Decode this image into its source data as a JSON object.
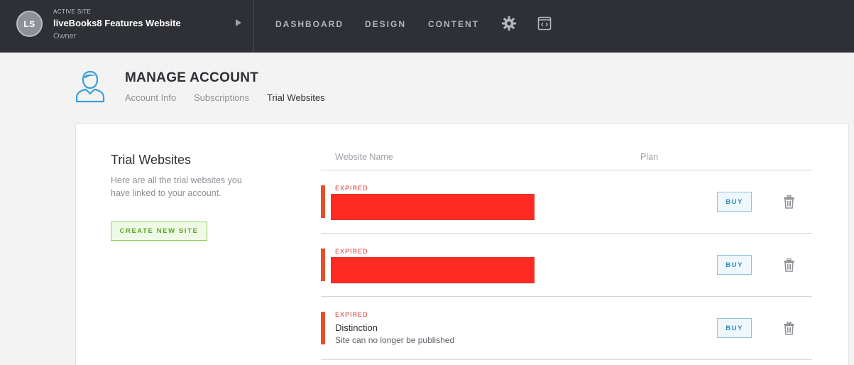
{
  "topbar": {
    "avatar_initials": "LS",
    "active_site_label": "ACTIVE SITE",
    "site_name": "liveBooks8 Features Website",
    "site_role": "Owner",
    "nav": [
      {
        "label": "DASHBOARD"
      },
      {
        "label": "DESIGN"
      },
      {
        "label": "CONTENT"
      }
    ],
    "icons": [
      "gear-icon",
      "code-embed-icon"
    ]
  },
  "header": {
    "title": "MANAGE ACCOUNT",
    "tabs": [
      {
        "label": "Account Info"
      },
      {
        "label": "Subscriptions"
      },
      {
        "label": "Trial Websites"
      }
    ],
    "active_tab": "Trial Websites"
  },
  "left": {
    "title": "Trial Websites",
    "description": "Here are all the trial websites you have linked to your account.",
    "create_button": "CREATE NEW SITE"
  },
  "table": {
    "headers": {
      "name": "Website Name",
      "plan": "Plan"
    },
    "rows": [
      {
        "status": "EXPIRED",
        "name": "",
        "note": "",
        "redacted": true,
        "buy": "BUY"
      },
      {
        "status": "EXPIRED",
        "name": "",
        "note": "",
        "redacted": true,
        "buy": "BUY"
      },
      {
        "status": "EXPIRED",
        "name": "Distinction",
        "note": "Site can no longer be published",
        "redacted": false,
        "buy": "BUY"
      }
    ]
  },
  "colors": {
    "topbar": "#2e3035",
    "expired": "#e94e2a",
    "create_green": "#5aa72a",
    "buy_blue": "#2e8bbd",
    "user_icon": "#3aa0d8"
  }
}
